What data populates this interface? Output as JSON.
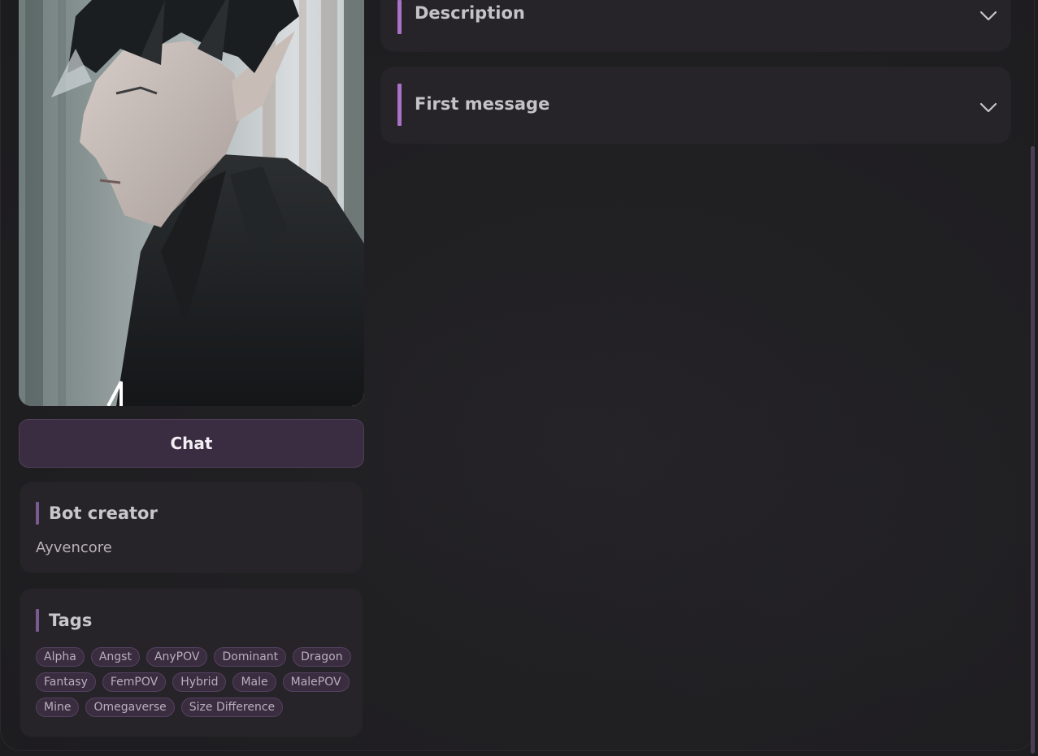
{
  "portrait": {
    "icon": "character-portrait-image"
  },
  "chat_button": {
    "label": "Chat"
  },
  "creator": {
    "title": "Bot creator",
    "name": "Ayvencore"
  },
  "tags": {
    "title": "Tags",
    "items": [
      "Alpha",
      "Angst",
      "AnyPOV",
      "Dominant",
      "Dragon",
      "Fantasy",
      "FemPOV",
      "Hybrid",
      "Male",
      "MalePOV",
      "Mine",
      "Omegaverse",
      "Size Difference"
    ]
  },
  "sections": {
    "description": {
      "title": "Description",
      "icon": "chevron-down-icon"
    },
    "first_message": {
      "title": "First message",
      "icon": "chevron-down-icon"
    }
  },
  "colors": {
    "accent": "#a972c6",
    "tag_bg": "#3a2d40",
    "button_bg": "#3a2d42"
  }
}
